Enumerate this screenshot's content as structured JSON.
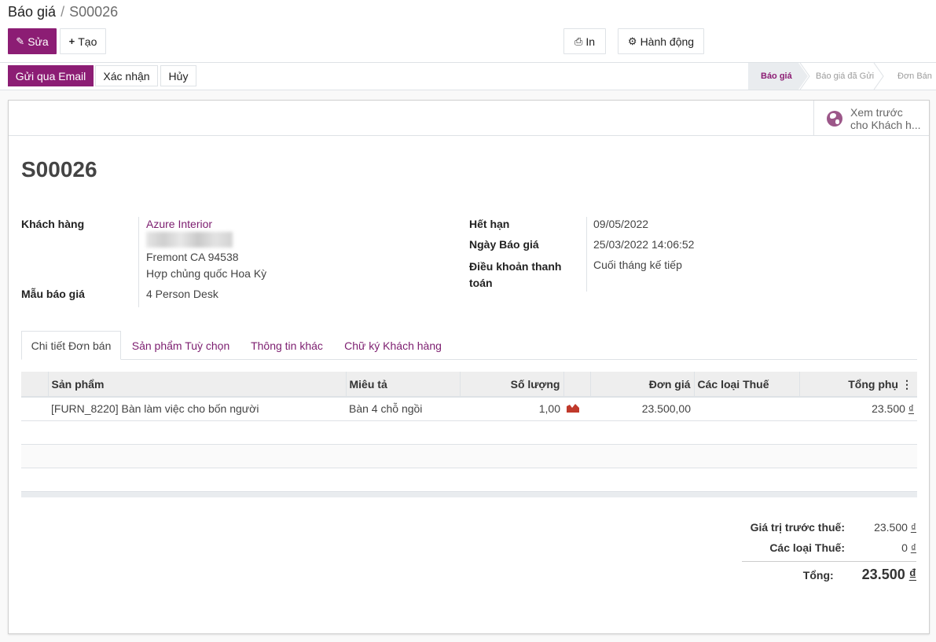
{
  "breadcrumb": {
    "parent": "Báo giá",
    "separator": "/",
    "current": "S00026"
  },
  "toolbar": {
    "edit": "Sửa",
    "create": "Tạo",
    "print": "In",
    "action": "Hành động"
  },
  "statusbar": {
    "buttons": {
      "send_email": "Gửi qua Email",
      "confirm": "Xác nhận",
      "cancel": "Hủy"
    },
    "stages": [
      {
        "label": "Báo giá",
        "active": true
      },
      {
        "label": "Báo giá đã Gửi",
        "active": false
      },
      {
        "label": "Đơn Bán",
        "active": false
      }
    ]
  },
  "preview": {
    "line1": "Xem trước",
    "line2": "cho Khách h..."
  },
  "record": {
    "name": "S00026"
  },
  "fields": {
    "customer_label": "Khách hàng",
    "customer_name": "Azure Interior",
    "customer_city": "Fremont CA 94538",
    "customer_country": "Hợp chủng quốc Hoa Kỳ",
    "template_label": "Mẫu báo giá",
    "template_value": "4 Person Desk",
    "expiration_label": "Hết hạn",
    "expiration_value": "09/05/2022",
    "quote_date_label": "Ngày Báo giá",
    "quote_date_value": "25/03/2022 14:06:52",
    "payment_terms_label_1": "Điều khoản thanh",
    "payment_terms_label_2": "toán",
    "payment_terms_value": "Cuối tháng kế tiếp"
  },
  "tabs": [
    {
      "label": "Chi tiết Đơn bán",
      "active": true
    },
    {
      "label": "Sản phẩm Tuỳ chọn",
      "active": false
    },
    {
      "label": "Thông tin khác",
      "active": false
    },
    {
      "label": "Chữ ký Khách hàng",
      "active": false
    }
  ],
  "lines": {
    "headers": {
      "product": "Sản phẩm",
      "description": "Miêu tả",
      "quantity": "Số lượng",
      "unit_price": "Đơn giá",
      "taxes": "Các loại Thuế",
      "subtotal": "Tổng phụ"
    },
    "rows": [
      {
        "product": "[FURN_8220] Bàn làm việc cho bốn người",
        "description": "Bàn 4 chỗ ngồi",
        "quantity": "1,00",
        "unit_price": "23.500,00",
        "taxes": "",
        "subtotal_amount": "23.500",
        "currency": "₫"
      }
    ]
  },
  "totals": {
    "untaxed_label": "Giá trị trước thuế:",
    "untaxed_amount": "23.500",
    "tax_label": "Các loại Thuế:",
    "tax_amount": "0",
    "total_label": "Tổng:",
    "total_amount": "23.500",
    "currency": "₫"
  },
  "colors": {
    "brand": "#8c1d74",
    "link": "#7c1d6f",
    "forecast_icon": "#c0392b"
  }
}
